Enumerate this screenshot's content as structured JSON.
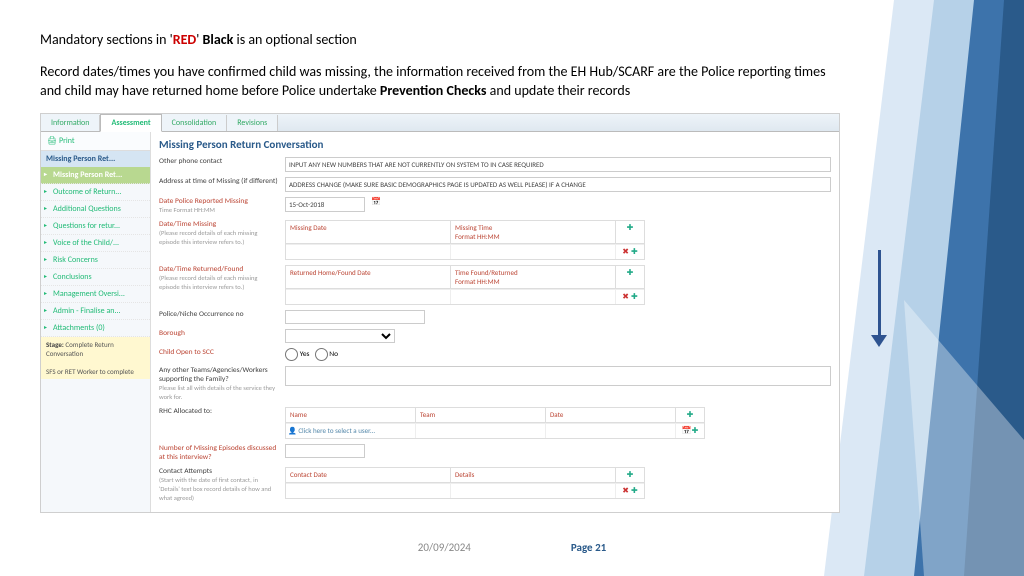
{
  "intro": {
    "line1a": "Mandatory sections in '",
    "line1b": "RED",
    "line1c": "' ",
    "line1d": "Black",
    "line1e": " is an optional section",
    "line2a": "Record dates/times you have confirmed child was missing, the information received from the EH Hub/SCARF are the Police reporting times and child may have returned home before Police undertake ",
    "line2b": "Prevention Checks",
    "line2c": " and update their records"
  },
  "tabs": {
    "t0": "Information",
    "t1": "Assessment",
    "t2": "Consolidation",
    "t3": "Revisions"
  },
  "sidebar": {
    "print": "Print",
    "head": "Missing Person Ret...",
    "i0": "Missing Person Ret...",
    "i1": "Outcome of Return...",
    "i2": "Additional Questions",
    "i3": "Questions for retur...",
    "i4": "Voice of the Child/...",
    "i5": "Risk Concerns",
    "i6": "Conclusions",
    "i7": "Management Oversi...",
    "i8": "Admin - Finalise an...",
    "i9": "Attachments (0)",
    "stage_label": "Stage:",
    "stage_val": "Complete Return Conversation",
    "stage_note": "SFS or RET Worker to complete"
  },
  "form": {
    "title": "Missing Person Return Conversation",
    "other_phone_lbl": "Other phone contact",
    "other_phone_val": "INPUT ANY NEW NUMBERS THAT ARE NOT CURRENTLY ON SYSTEM TO IN CASE REQUIRED",
    "addr_lbl": "Address at time of Missing (if different)",
    "addr_val": "ADDRESS CHANGE (MAKE SURE BASIC DEMOGRAPHICS PAGE IS UPDATED AS WELL PLEASE) IF A CHANGE",
    "police_date_lbl": "Date Police Reported Missing",
    "police_date_hint": "Time Format HH:MM",
    "police_date_val": "15-Oct-2018",
    "missing_lbl": "Date/Time Missing",
    "missing_hint": "(Please record details of each missing episode this interview refers to.)",
    "missing_th1": "Missing Date",
    "missing_th2": "Missing Time",
    "missing_th2_hint": "Format HH:MM",
    "found_lbl": "Date/Time Returned/Found",
    "found_hint": "(Please record details of each missing episode this interview refers to.)",
    "found_th1": "Returned Home/Found Date",
    "found_th2": "Time Found/Returned",
    "found_th2_hint": "Format HH:MM",
    "occ_lbl": "Police/Niche Occurrence no",
    "borough_lbl": "Borough",
    "child_scc_lbl": "Child Open to SCC",
    "yes": "Yes",
    "no": "No",
    "other_teams_lbl": "Any other Teams/Agencies/Workers supporting the Family?",
    "other_teams_hint": "Please list all with details of the service they work for.",
    "rhc_lbl": "RHC Allocated to:",
    "rhc_th1": "Name",
    "rhc_th2": "Team",
    "rhc_th3": "Date",
    "rhc_pick": "Click here to select a user...",
    "episodes_lbl": "Number of Missing Episodes discussed at this interview?",
    "contact_lbl": "Contact Attempts",
    "contact_hint": "(Start with the date of first contact, in 'Details' text box record details of how and what agreed)",
    "contact_th1": "Contact Date",
    "contact_th2": "Details"
  },
  "footer": {
    "date": "20/09/2024",
    "page": "Page 21"
  }
}
